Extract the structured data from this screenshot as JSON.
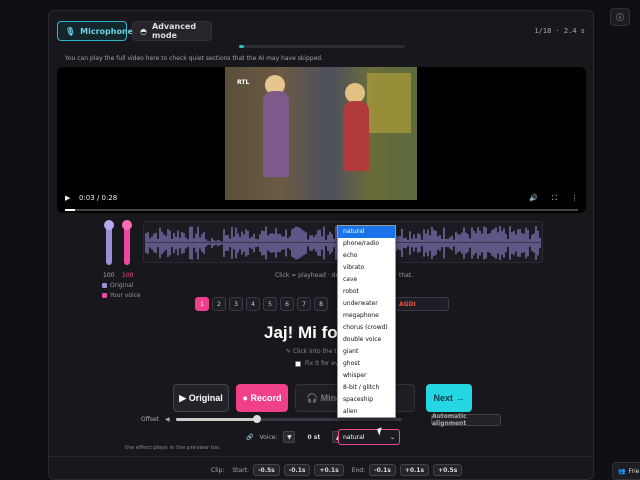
{
  "header": {
    "mode_microphone": "Microphone",
    "mode_advanced": "Advanced mode",
    "counter": "1/18 · 2.4 s",
    "progress_fraction": 0.03,
    "hint": "You can play the full video here to check quiet sections that the AI may have skipped."
  },
  "video": {
    "time": "0:03 / 0:28",
    "channel_logo": "RTL",
    "progress_fraction": 0.02
  },
  "volumes": {
    "original": "100",
    "voice": "100",
    "legend_original": "Original",
    "legend_voice": "Your voice"
  },
  "waveform": {
    "hint_left": "Click = playhead · drag",
    "hint_right": "that."
  },
  "pages": [
    "1",
    "2",
    "3",
    "4",
    "5",
    "6",
    "7",
    "8"
  ],
  "fragment_select": "AGDI",
  "phrase": {
    "text": "Jaj! Mi foly",
    "hint": "Click into the text",
    "fix_label": "Fix it for ever"
  },
  "buttons": {
    "original": "▶ Original",
    "record": "● Record",
    "mine": "Mine",
    "silence": "nce",
    "next": "Next →"
  },
  "offset": {
    "label": "Offset",
    "value_fraction": 0.36,
    "auto_align": "Automatic alignment"
  },
  "voice": {
    "label": "Voice:",
    "semitones": "0 st",
    "selected": "natural",
    "options": [
      "natural",
      "phone/radio",
      "echo",
      "vibrato",
      "cave",
      "robot",
      "underwater",
      "megaphone",
      "chorus (crowd)",
      "double voice",
      "giant",
      "ghost",
      "whisper",
      "8-bit / glitch",
      "spaceship",
      "alien"
    ]
  },
  "preview_note": "the effect plays in the preview too",
  "clip": {
    "label": "Clip:",
    "start_label": "Start:",
    "end_label": "End:",
    "start_buttons": [
      "-0.5s",
      "-0.1s",
      "+0.1s"
    ],
    "end_buttons": [
      "-0.1s",
      "+0.1s",
      "+0.5s"
    ]
  },
  "corner": {
    "friends": "Frie"
  },
  "colors": {
    "accent_pink": "#ef3f8c",
    "accent_cyan": "#25d7e3",
    "original_purple": "#9f8ed6"
  }
}
